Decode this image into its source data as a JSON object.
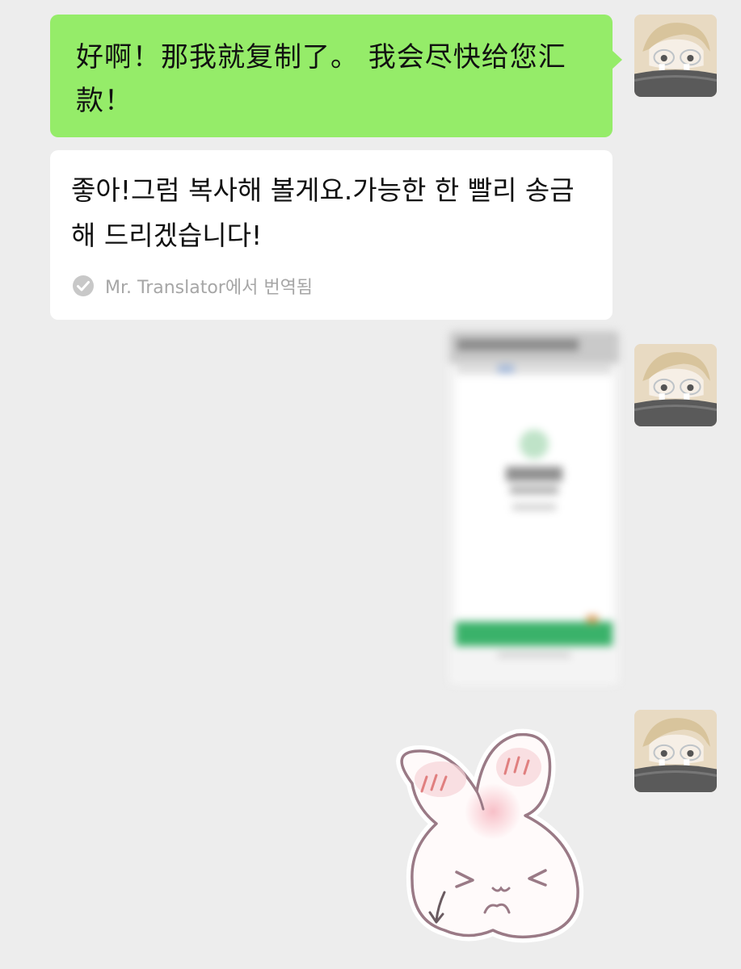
{
  "messages": [
    {
      "type": "text",
      "sender": "self",
      "text": "好啊！那我就复制了。 我会尽快给您汇款！",
      "translation": {
        "text": "좋아!그럼 복사해 볼게요.가능한 한 빨리 송금해 드리겠습니다!",
        "source_label": "Mr. Translator에서 번역됨"
      }
    },
    {
      "type": "image",
      "sender": "self"
    },
    {
      "type": "sticker",
      "sender": "self"
    }
  ],
  "colors": {
    "background": "#ededed",
    "outgoing_bubble": "#95ec69",
    "translation_card": "#ffffff",
    "secondary_text": "#a6a6a6"
  },
  "icons": {
    "translation_check": "check-circle-icon",
    "avatar": "user-avatar"
  }
}
